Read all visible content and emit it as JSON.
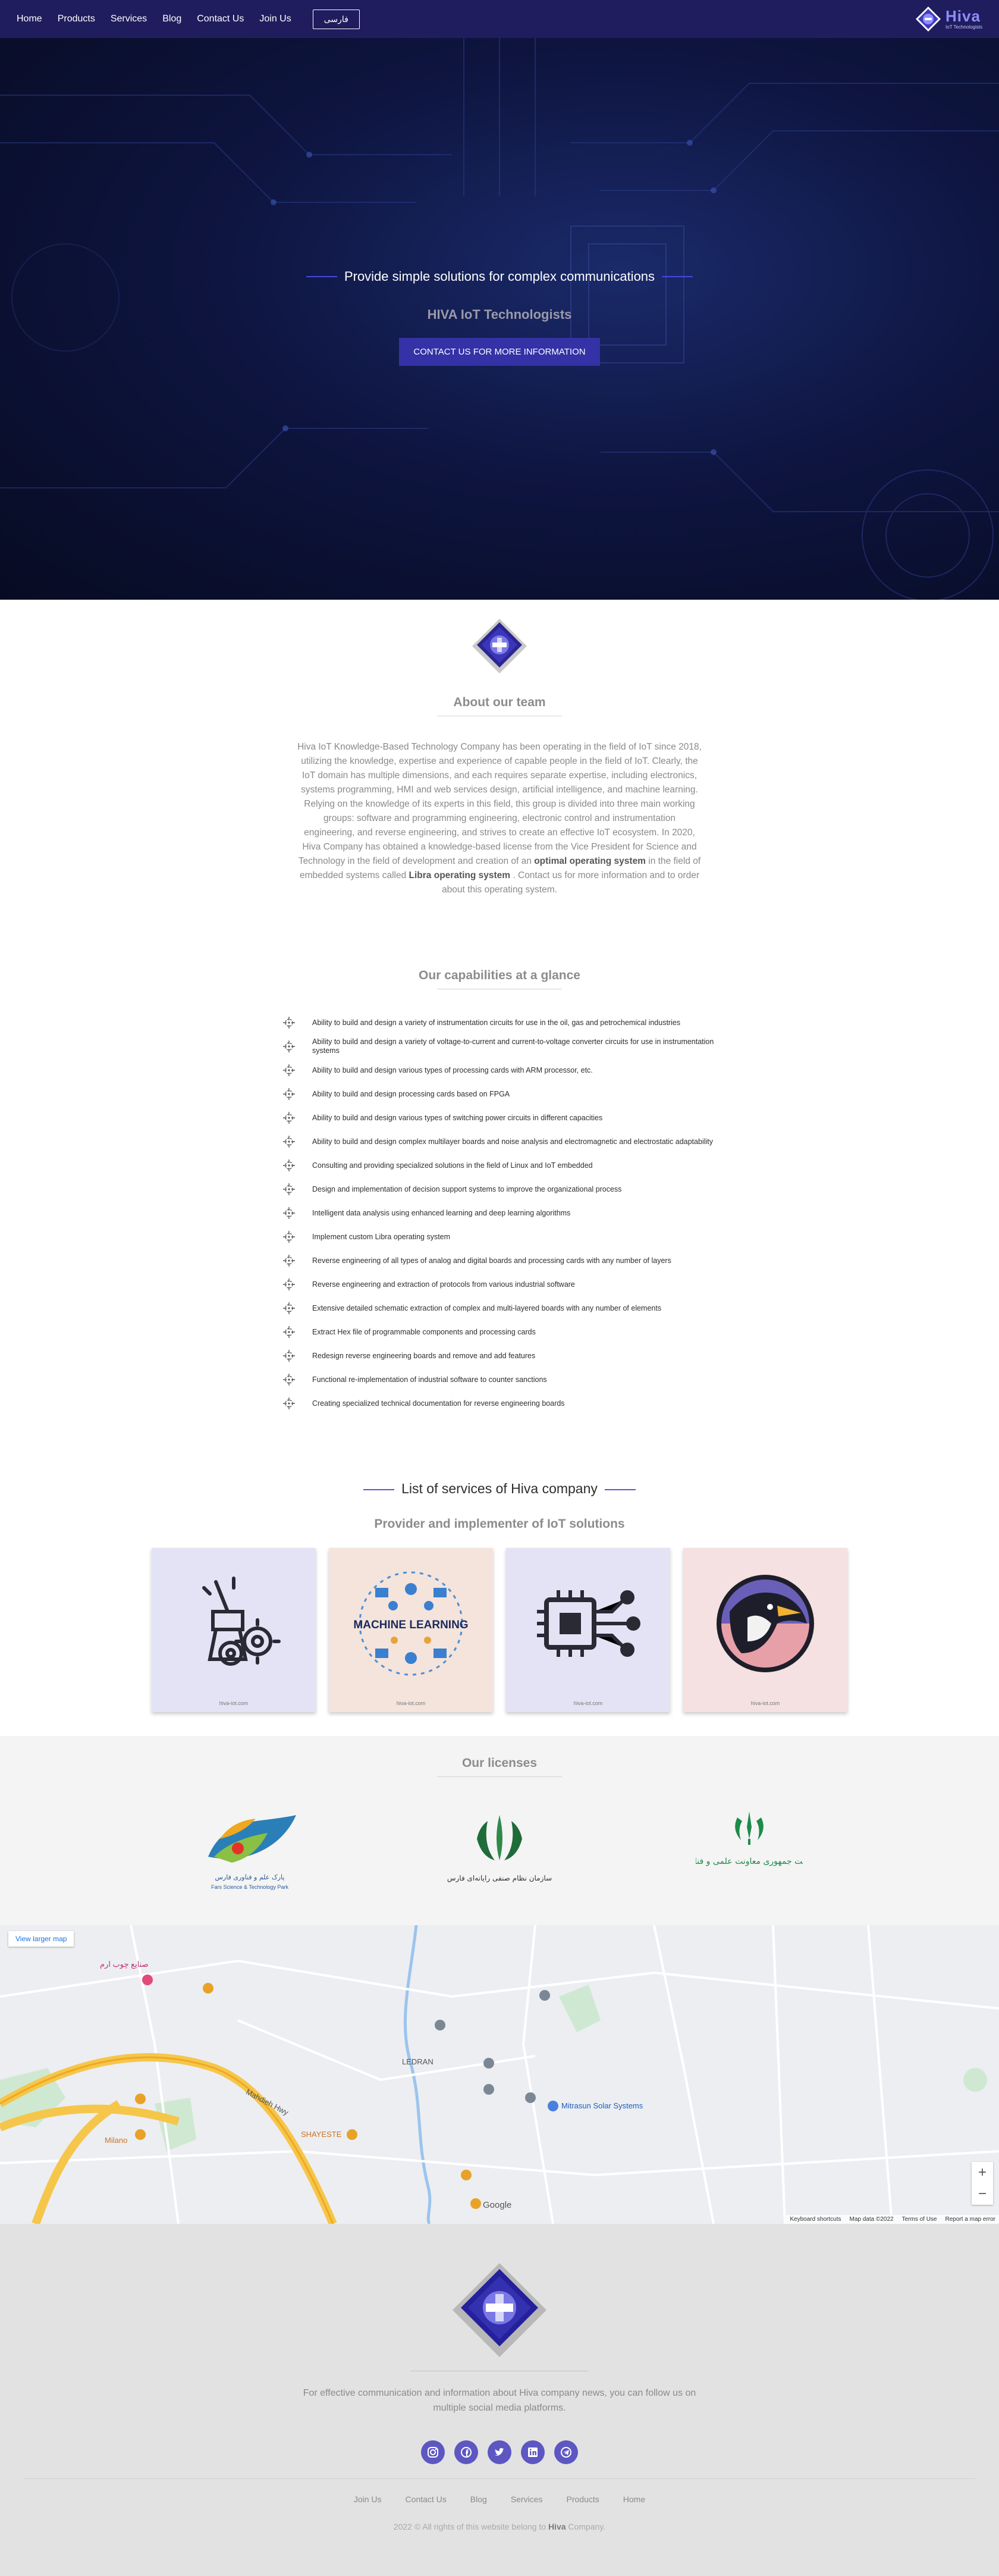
{
  "nav": {
    "links": [
      "Home",
      "Products",
      "Services",
      "Blog",
      "Contact Us",
      "Join Us"
    ],
    "lang_button": "فارسی",
    "brand_name": "Hiva",
    "brand_sub": "IoT Technologists"
  },
  "hero": {
    "headline": "Provide simple solutions for complex communications",
    "subtitle": "HIVA IoT Technologists",
    "cta": "CONTACT US FOR MORE INFORMATION"
  },
  "about": {
    "title": "About our team",
    "text_part1": "Hiva IoT Knowledge-Based Technology Company has been operating in the field of IoT since 2018, utilizing the knowledge, expertise and experience of capable people in the field of IoT. Clearly, the IoT domain has multiple dimensions, and each requires separate expertise, including electronics, systems programming, HMI and web services design, artificial intelligence, and machine learning. Relying on the knowledge of its experts in this field, this group is divided into three main working groups: software and programming engineering, electronic control and instrumentation engineering, and reverse engineering, and strives to create an effective IoT ecosystem. In 2020, Hiva Company has obtained a knowledge-based license from the Vice President for Science and Technology in the field of development and creation of an ",
    "bold1": "optimal operating system",
    "text_part2": " in the field of embedded systems called ",
    "bold2": "Libra operating system",
    "text_part3": " . Contact us for more information and to order about this operating system."
  },
  "capabilities": {
    "title": "Our capabilities at a glance",
    "items": [
      "Ability to build and design a variety of instrumentation circuits for use in the oil, gas and petrochemical industries",
      "Ability to build and design a variety of voltage-to-current and current-to-voltage converter circuits for use in instrumentation systems",
      "Ability to build and design various types of processing cards with ARM processor, etc.",
      "Ability to build and design processing cards based on FPGA",
      "Ability to build and design various types of switching power circuits in different capacities",
      "Ability to build and design complex multilayer boards and noise analysis and electromagnetic and electrostatic adaptability",
      "Consulting and providing specialized solutions in the field of Linux and IoT embedded",
      "Design and implementation of decision support systems to improve the organizational process",
      "Intelligent data analysis using enhanced learning and deep learning algorithms",
      "Implement custom Libra operating system",
      "Reverse engineering of all types of analog and digital boards and processing cards with any number of layers",
      "Reverse engineering and extraction of protocols from various industrial software",
      "Extensive detailed schematic extraction of complex and multi-layered boards with any number of elements",
      "Extract Hex file of programmable components and processing cards",
      "Redesign reverse engineering boards and remove and add features",
      "Functional re-implementation of industrial software to counter sanctions",
      "Creating specialized technical documentation for reverse engineering boards"
    ]
  },
  "services": {
    "title": "List of services of Hiva company",
    "subtitle": "Provider and implementer of IoT solutions",
    "cards": [
      {
        "caption": "hiva-iot.com",
        "bg": "#e3e3f5",
        "icon": "hand-gear-icon"
      },
      {
        "caption": "hiva-iot.com",
        "bg": "#f4e4dc",
        "icon": "machine-learning-icon",
        "text": "MACHINE LEARNING"
      },
      {
        "caption": "hiva-iot.com",
        "bg": "#e3e3f5",
        "icon": "chip-icon"
      },
      {
        "caption": "hiva-iot.com",
        "bg": "#f5e1e1",
        "icon": "penguin-icon"
      }
    ]
  },
  "licenses": {
    "title": "Our licenses",
    "items": [
      {
        "icon": "fars-science-park-logo",
        "caption": "Fars Science & Technology Park",
        "caption_fa": "پارک علم و فناوری فارس"
      },
      {
        "icon": "fars-industrial-logo",
        "caption_fa": "سازمان نظام صنفی رایانه‌ای فارس"
      },
      {
        "icon": "presidency-logo",
        "caption_fa": "ریاست جمهوری معاونت علمی و فناوری"
      }
    ]
  },
  "map": {
    "link": "View larger map",
    "labels": [
      "صنایع چوب ارم",
      "Mahdieh Hwy",
      "LEDRAN",
      "Mitrasun Solar Systems",
      "SHAYESTE",
      "Milano",
      "Google"
    ],
    "footer": [
      "Keyboard shortcuts",
      "Map data ©2022",
      "Terms of Use",
      "Report a map error"
    ],
    "zoom_in": "+",
    "zoom_out": "−"
  },
  "footer": {
    "text": "For effective communication and information about Hiva company news, you can follow us on multiple social media platforms.",
    "socials": [
      "instagram-icon",
      "facebook-icon",
      "twitter-icon",
      "linkedin-icon",
      "telegram-icon"
    ],
    "links": [
      "Join Us",
      "Contact Us",
      "Blog",
      "Services",
      "Products",
      "Home"
    ],
    "copyright_pre": "2022 © All rights of this website belong to ",
    "copyright_brand": "Hiva",
    "copyright_post": " Company."
  },
  "colors": {
    "nav_bg": "#1f1d5e",
    "accent": "#3432a6",
    "brand": "#8e8cff"
  }
}
